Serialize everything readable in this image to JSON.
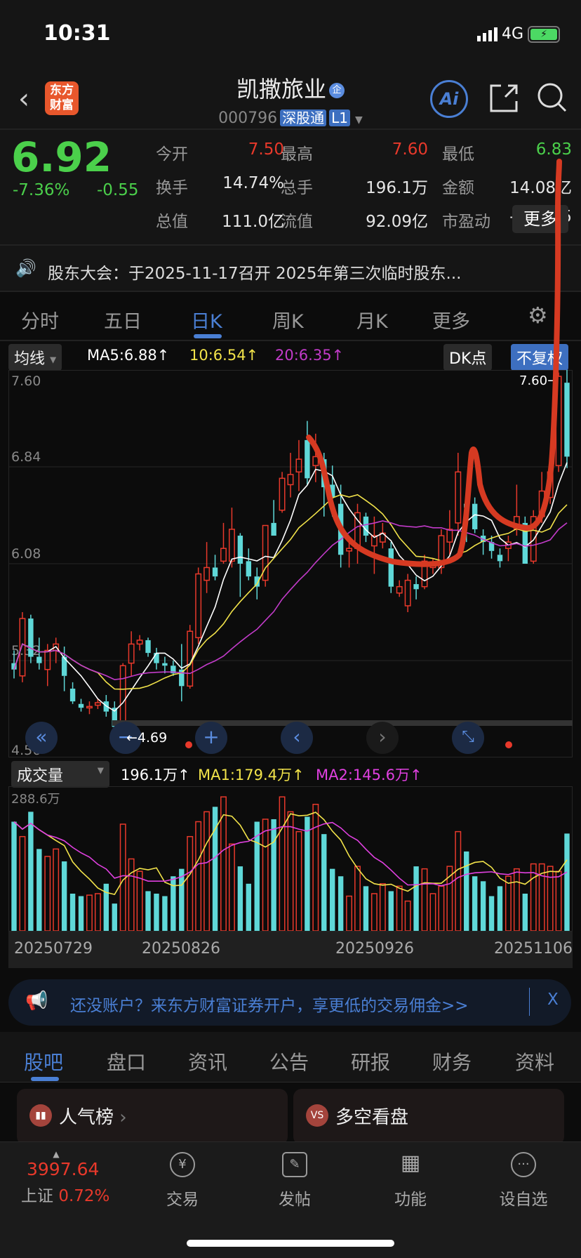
{
  "status": {
    "time": "10:31",
    "network": "4G",
    "battery": "charging"
  },
  "header": {
    "title": "凯撒旅业",
    "title_badge": "企",
    "code": "000796",
    "tags": [
      "深股通",
      "L1"
    ],
    "logo": [
      "东方",
      "财富"
    ],
    "icons": [
      "back-icon",
      "ai-icon",
      "share-icon",
      "search-icon"
    ]
  },
  "quote": {
    "price": "6.92",
    "pct": "-7.36%",
    "chg": "-0.55",
    "fields": [
      {
        "label": "今开",
        "value": "7.50",
        "color": "r"
      },
      {
        "label": "最高",
        "value": "7.60",
        "color": "r"
      },
      {
        "label": "最低",
        "value": "6.83",
        "color": "g"
      },
      {
        "label": "换手",
        "value": "14.74%",
        "color": "w"
      },
      {
        "label": "总手",
        "value": "196.1万",
        "color": "w"
      },
      {
        "label": "金额",
        "value": "14.08亿",
        "color": "w"
      },
      {
        "label": "总值",
        "value": "111.0亿",
        "color": "w"
      },
      {
        "label": "流值",
        "value": "92.09亿",
        "color": "w"
      },
      {
        "label": "市盈动",
        "value": "-310.85",
        "color": "w"
      }
    ],
    "more": "更多"
  },
  "notice": "股东大会：于2025-11-17召开 2025年第三次临时股东...",
  "tabs": [
    "分时",
    "五日",
    "日K",
    "周K",
    "月K",
    "更多"
  ],
  "active_tab": "日K",
  "ma": {
    "selector": "均线",
    "ma5": "MA5:6.88↑",
    "ma10": "10:6.54↑",
    "ma20": "20:6.35↑",
    "dk": "DK点",
    "fq": "不复权"
  },
  "colors": {
    "up": "#e8392b",
    "down": "#5fd8d8",
    "ma5": "#ffffff",
    "ma10": "#f2e34a",
    "ma20": "#c23bc9",
    "accent": "#4a7fd4",
    "annotation": "#d63a22"
  },
  "chart_data": {
    "type": "candlestick",
    "y_ticks": [
      "7.60",
      "6.84",
      "6.08",
      "5.32",
      "4.56"
    ],
    "ylim": [
      4.56,
      7.6
    ],
    "max_label": "7.60",
    "min_label": "4.69",
    "ohlc": [
      [
        5.3,
        5.4,
        5.18,
        5.25
      ],
      [
        5.2,
        5.7,
        5.15,
        5.65
      ],
      [
        5.65,
        5.68,
        5.3,
        5.35
      ],
      [
        5.35,
        5.5,
        5.25,
        5.3
      ],
      [
        5.25,
        5.45,
        5.12,
        5.4
      ],
      [
        5.4,
        5.5,
        5.3,
        5.45
      ],
      [
        5.35,
        5.43,
        5.08,
        5.2
      ],
      [
        5.1,
        5.15,
        4.98,
        5.0
      ],
      [
        4.98,
        5.02,
        4.92,
        4.95
      ],
      [
        4.95,
        5.0,
        4.9,
        4.96
      ],
      [
        4.97,
        5.02,
        4.94,
        4.99
      ],
      [
        5.0,
        5.05,
        4.88,
        4.92
      ],
      [
        4.95,
        5.0,
        4.69,
        4.8
      ],
      [
        4.8,
        5.3,
        4.78,
        5.28
      ],
      [
        5.3,
        5.55,
        5.2,
        5.45
      ],
      [
        5.45,
        5.52,
        5.4,
        5.48
      ],
      [
        5.48,
        5.5,
        5.35,
        5.38
      ],
      [
        5.38,
        5.42,
        5.25,
        5.3
      ],
      [
        5.3,
        5.35,
        5.22,
        5.28
      ],
      [
        5.28,
        5.32,
        5.2,
        5.22
      ],
      [
        5.25,
        5.45,
        5.0,
        5.12
      ],
      [
        5.12,
        5.6,
        5.1,
        5.55
      ],
      [
        5.5,
        6.05,
        5.45,
        6.0
      ],
      [
        5.95,
        6.25,
        5.85,
        6.05
      ],
      [
        6.05,
        6.15,
        5.95,
        5.98
      ],
      [
        6.1,
        6.4,
        6.08,
        6.2
      ],
      [
        6.1,
        6.52,
        6.05,
        6.35
      ],
      [
        6.3,
        6.32,
        5.82,
        6.08
      ],
      [
        6.1,
        6.2,
        5.95,
        5.98
      ],
      [
        5.98,
        6.05,
        5.8,
        5.9
      ],
      [
        5.95,
        6.38,
        5.9,
        6.38
      ],
      [
        6.4,
        6.58,
        6.3,
        6.3
      ],
      [
        6.5,
        6.8,
        6.48,
        6.75
      ],
      [
        6.7,
        6.95,
        6.6,
        6.78
      ],
      [
        6.8,
        7.05,
        6.65,
        6.9
      ],
      [
        7.05,
        7.2,
        6.7,
        6.75
      ],
      [
        6.85,
        7.1,
        6.72,
        6.92
      ],
      [
        6.9,
        6.95,
        6.45,
        6.68
      ],
      [
        6.7,
        6.85,
        6.45,
        6.6
      ],
      [
        6.55,
        6.7,
        6.05,
        6.15
      ],
      [
        6.18,
        6.25,
        6.05,
        6.2
      ],
      [
        6.2,
        6.55,
        6.08,
        6.48
      ],
      [
        6.45,
        6.48,
        6.25,
        6.3
      ],
      [
        6.22,
        6.45,
        6.0,
        6.3
      ],
      [
        6.25,
        6.4,
        6.2,
        6.32
      ],
      [
        6.2,
        6.25,
        5.85,
        5.9
      ],
      [
        5.85,
        5.95,
        5.82,
        5.9
      ],
      [
        5.75,
        6.0,
        5.7,
        5.95
      ],
      [
        5.92,
        5.98,
        5.8,
        5.88
      ],
      [
        5.9,
        6.15,
        5.88,
        6.1
      ],
      [
        6.05,
        6.12,
        6.0,
        6.08
      ],
      [
        6.05,
        6.35,
        6.0,
        6.3
      ],
      [
        6.25,
        6.5,
        6.15,
        6.35
      ],
      [
        6.4,
        6.95,
        6.3,
        6.8
      ],
      [
        6.55,
        6.6,
        6.25,
        6.52
      ],
      [
        6.55,
        6.6,
        6.32,
        6.35
      ],
      [
        6.3,
        6.35,
        6.15,
        6.25
      ],
      [
        6.25,
        6.3,
        6.12,
        6.18
      ],
      [
        6.15,
        6.2,
        6.05,
        6.1
      ],
      [
        6.2,
        6.3,
        6.1,
        6.25
      ],
      [
        6.35,
        6.7,
        6.3,
        6.45
      ],
      [
        6.4,
        6.45,
        6.08,
        6.08
      ],
      [
        6.1,
        6.5,
        6.08,
        6.45
      ],
      [
        6.45,
        6.8,
        6.4,
        6.65
      ],
      [
        6.6,
        6.9,
        6.55,
        6.8
      ],
      [
        6.85,
        7.58,
        6.8,
        7.55
      ],
      [
        7.5,
        7.6,
        6.83,
        6.92
      ]
    ],
    "volume": {
      "selector": "成交量",
      "current": "196.1万↑",
      "ma1": "MA1:179.4万↑",
      "ma2": "MA2:145.6万↑",
      "max_label": "288.6万",
      "max": 288.6,
      "values": [
        220,
        190,
        240,
        165,
        150,
        165,
        140,
        75,
        70,
        72,
        75,
        95,
        55,
        215,
        145,
        120,
        80,
        75,
        70,
        110,
        125,
        190,
        220,
        240,
        250,
        270,
        175,
        130,
        95,
        220,
        225,
        225,
        270,
        240,
        200,
        230,
        255,
        195,
        125,
        110,
        70,
        130,
        90,
        75,
        95,
        80,
        90,
        60,
        130,
        125,
        75,
        90,
        130,
        200,
        160,
        110,
        100,
        70,
        90,
        110,
        125,
        75,
        135,
        135,
        130,
        120,
        196.1
      ]
    },
    "x_labels": [
      "20250729",
      "20250826",
      "20250926",
      "20251106"
    ]
  },
  "chart_nav": [
    "double-left-icon",
    "zoom-out-icon",
    "zoom-in-icon",
    "left-icon",
    "right-icon",
    "fullscreen-icon"
  ],
  "banner": {
    "text": "还没账户？来东方财富证券开户，享更低的交易佣金>>",
    "close": "X"
  },
  "bottom_tabs": [
    "股吧",
    "盘口",
    "资讯",
    "公告",
    "研报",
    "财务",
    "资料"
  ],
  "cards": [
    {
      "title": "人气榜",
      "icon": "ranking-icon"
    },
    {
      "title": "多空看盘",
      "icon": "vs-icon"
    }
  ],
  "index": {
    "value": "3997.64",
    "name": "上证",
    "pct": "0.72%"
  },
  "nav": [
    {
      "label": "交易",
      "icon": "¥"
    },
    {
      "label": "发帖",
      "icon": "✎"
    },
    {
      "label": "功能",
      "icon": "▦"
    },
    {
      "label": "设自选",
      "icon": "···"
    }
  ]
}
